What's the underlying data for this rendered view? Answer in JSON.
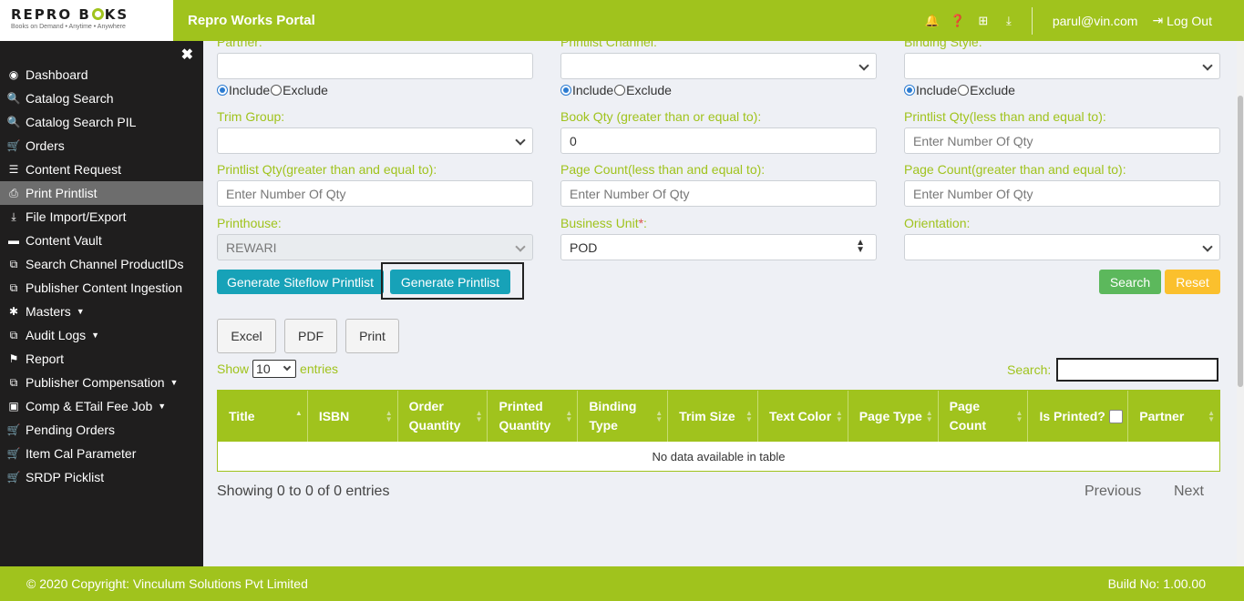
{
  "header": {
    "logo_text_a": "REPRO B",
    "logo_text_b": "KS",
    "logo_tagline": "Books on Demand • Anytime • Anywhere",
    "portal_title": "Repro Works Portal",
    "user_email": "parul@vin.com",
    "logout_label": "Log Out"
  },
  "sidebar": {
    "close_glyph": "✖",
    "items": [
      {
        "label": "Dashboard",
        "icon": "dashboard-icon",
        "glyph": "◉"
      },
      {
        "label": "Catalog Search",
        "icon": "search-icon",
        "glyph": "🔍"
      },
      {
        "label": "Catalog Search PIL",
        "icon": "search-icon",
        "glyph": "🔍"
      },
      {
        "label": "Orders",
        "icon": "cart-icon",
        "glyph": "🛒"
      },
      {
        "label": "Content Request",
        "icon": "list-icon",
        "glyph": "☰"
      },
      {
        "label": "Print Printlist",
        "icon": "print-icon",
        "glyph": "⎙"
      },
      {
        "label": "File Import/Export",
        "icon": "download-icon",
        "glyph": "⤓"
      },
      {
        "label": "Content Vault",
        "icon": "folder-icon",
        "glyph": "▬"
      },
      {
        "label": "Search Channel ProductIDs",
        "icon": "clone-icon",
        "glyph": "⧉"
      },
      {
        "label": "Publisher Content Ingestion",
        "icon": "clone-icon",
        "glyph": "⧉"
      },
      {
        "label": "Masters",
        "icon": "asterisk-icon",
        "glyph": "✱"
      },
      {
        "label": "Audit Logs",
        "icon": "clone-icon",
        "glyph": "⧉"
      },
      {
        "label": "Report",
        "icon": "flag-icon",
        "glyph": "⚑"
      },
      {
        "label": "Publisher Compensation",
        "icon": "clone-icon",
        "glyph": "⧉"
      },
      {
        "label": "Comp & ETail Fee Job",
        "icon": "money-icon",
        "glyph": "▣"
      },
      {
        "label": "Pending Orders",
        "icon": "cart-icon",
        "glyph": "🛒"
      },
      {
        "label": "Item Cal Parameter",
        "icon": "cart-icon",
        "glyph": "🛒"
      },
      {
        "label": "SRDP Picklist",
        "icon": "cart-icon",
        "glyph": "🛒"
      }
    ]
  },
  "filters": {
    "partner_label": "Partner:",
    "partner_value": "",
    "printlist_channel_label": "Printlist Channel:",
    "printlist_channel_value": "",
    "binding_style_label": "Binding Style:",
    "binding_style_value": "",
    "include_label": "Include",
    "exclude_label": "Exclude",
    "trim_group_label": "Trim Group:",
    "trim_group_value": "",
    "book_qty_label": "Book Qty (greater than or equal to):",
    "book_qty_value": "0",
    "printlist_qty_le_label": "Printlist Qty(less than and equal to):",
    "printlist_qty_le_placeholder": "Enter Number Of Qty",
    "printlist_qty_ge_label": "Printlist Qty(greater than and equal to):",
    "printlist_qty_ge_placeholder": "Enter Number Of Qty",
    "page_count_le_label": "Page Count(less than and equal to):",
    "page_count_le_placeholder": "Enter Number Of Qty",
    "page_count_ge_label": "Page Count(greater than and equal to):",
    "page_count_ge_placeholder": "Enter Number Of Qty",
    "printhouse_label": "Printhouse:",
    "printhouse_value": "REWARI",
    "business_unit_label": "Business Unit",
    "business_unit_required": "*",
    "business_unit_colon": ":",
    "business_unit_value": "POD",
    "orientation_label": "Orientation:",
    "orientation_value": ""
  },
  "actions": {
    "generate_siteflow": "Generate Siteflow Printlist",
    "generate_printlist": "Generate Printlist",
    "search": "Search",
    "reset": "Reset",
    "excel": "Excel",
    "pdf": "PDF",
    "print": "Print"
  },
  "table_controls": {
    "show_label": "Show",
    "entries_label": "entries",
    "page_length": "10",
    "search_label": "Search:"
  },
  "table": {
    "columns": [
      "Title",
      "ISBN",
      "Order Quantity",
      "Printed Quantity",
      "Binding Type",
      "Trim Size",
      "Text Color",
      "Page Type",
      "Page Count",
      "Is Printed?",
      "Partner"
    ],
    "empty_message": "No data available in table",
    "showing": "Showing 0 to 0 of 0 entries",
    "previous": "Previous",
    "next": "Next"
  },
  "footer": {
    "copyright": "© 2020 Copyright: Vinculum Solutions Pvt Limited",
    "build": "Build No: 1.00.00"
  },
  "colors": {
    "brand_green": "#a0c31d",
    "sidebar_bg": "#1f1e1e",
    "teal": "#17a2b8",
    "search_green": "#5cb85c",
    "reset_yellow": "#fbc02d"
  }
}
